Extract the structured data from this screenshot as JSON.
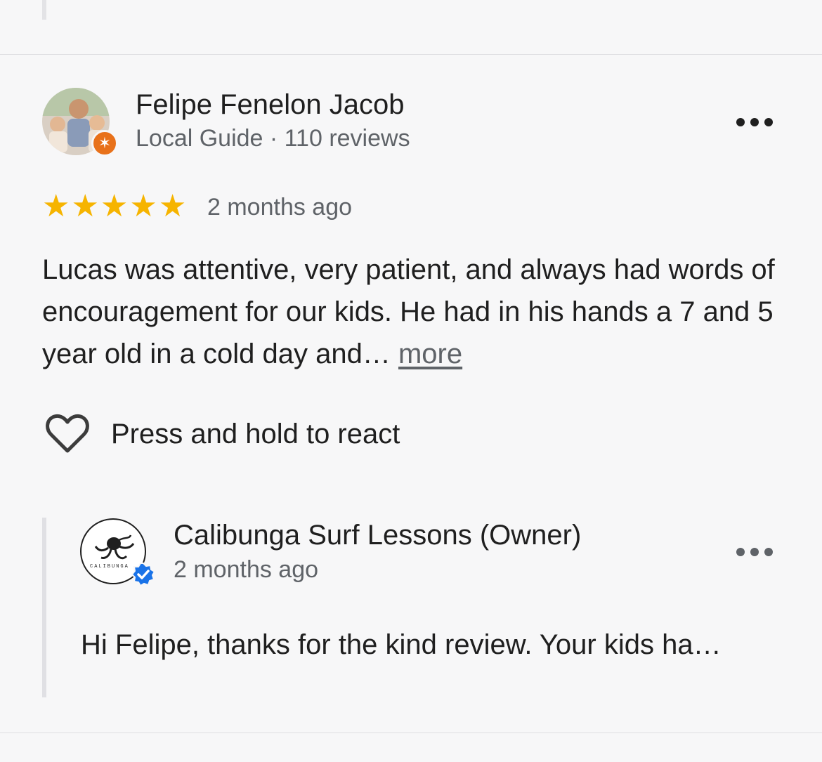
{
  "review": {
    "reviewer_name": "Felipe Fenelon Jacob",
    "reviewer_meta": "Local Guide · 110 reviews",
    "rating": 5,
    "stars": [
      "★",
      "★",
      "★",
      "★",
      "★"
    ],
    "date": "2 months ago",
    "body": "Lucas was attentive, very patient, and always had words of encouragement for our kids. He had in his hands a 7 and 5 year old in a cold day and…",
    "more_label": "more",
    "react_label": "Press and hold to react"
  },
  "owner_reply": {
    "name": "Calibunga Surf Lessons (Owner)",
    "date": "2 months ago",
    "text": "Hi Felipe, thanks for the kind review. Your kids ha…",
    "logo_text": "CALIBUNGA"
  },
  "colors": {
    "star": "#f6b400",
    "guide_badge": "#e8711a",
    "verified": "#1a73e8",
    "muted_text": "#5f6368"
  },
  "icons": {
    "guide_badge": "local-guide-star-icon",
    "more": "more-horizontal-icon",
    "react": "heart-outline-icon",
    "verified": "verified-check-icon"
  }
}
